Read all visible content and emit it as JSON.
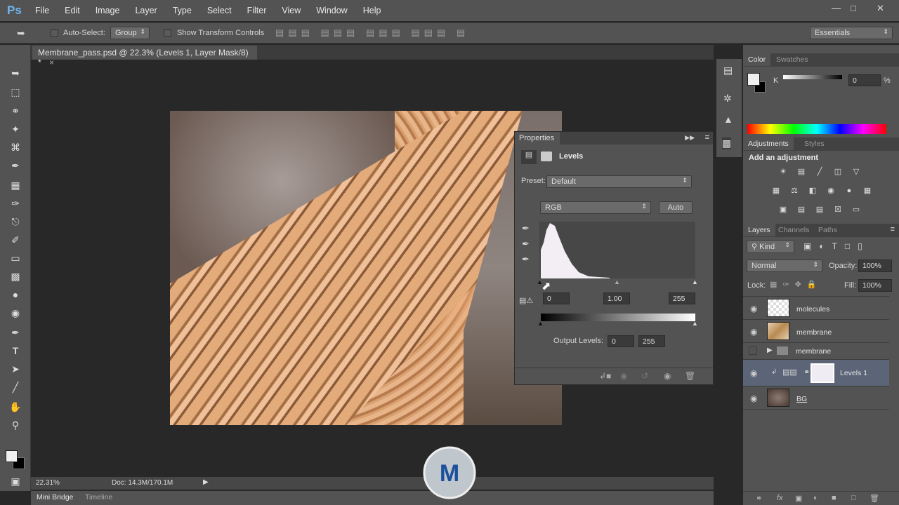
{
  "app": {
    "logo": "Ps",
    "menu": [
      "File",
      "Edit",
      "Image",
      "Layer",
      "Type",
      "Select",
      "Filter",
      "View",
      "Window",
      "Help"
    ],
    "window_controls": [
      "minimize",
      "maximize",
      "close"
    ]
  },
  "options": {
    "auto_select_label": "Auto-Select:",
    "auto_select_value": "Group",
    "transform_label": "Show Transform Controls",
    "workspace": "Essentials"
  },
  "document": {
    "tab_title": "Membrane_pass.psd @ 22.3% (Levels 1, Layer Mask/8) *",
    "zoom": "22.31%",
    "doc_size": "Doc: 14.3M/170.1M"
  },
  "bottom_tabs": [
    "Mini Bridge",
    "Timeline"
  ],
  "properties": {
    "title": "Properties",
    "adjustment": "Levels",
    "preset_label": "Preset:",
    "preset_value": "Default",
    "channel": "RGB",
    "auto_label": "Auto",
    "input_black": "0",
    "input_gamma": "1.00",
    "input_white": "255",
    "output_label": "Output Levels:",
    "output_black": "0",
    "output_white": "255"
  },
  "color_panel": {
    "tabs": [
      "Color",
      "Swatches"
    ],
    "channel": "K",
    "value": "0",
    "unit": "%"
  },
  "adjustments_panel": {
    "tabs": [
      "Adjustments",
      "Styles"
    ],
    "heading": "Add an adjustment"
  },
  "layers_panel": {
    "tabs": [
      "Layers",
      "Channels",
      "Paths"
    ],
    "filter": "Kind",
    "blend_mode": "Normal",
    "opacity_label": "Opacity:",
    "opacity": "100%",
    "lock_label": "Lock:",
    "fill_label": "Fill:",
    "fill": "100%",
    "layers": [
      {
        "name": "molecules",
        "visible": true
      },
      {
        "name": "membrane",
        "visible": true
      },
      {
        "name": "membrane",
        "visible": false,
        "type": "group"
      },
      {
        "name": "Levels 1",
        "visible": true,
        "selected": true,
        "type": "adjustment"
      },
      {
        "name": "BG",
        "visible": true
      }
    ]
  },
  "colors": {
    "accent": "#6fb6f0",
    "selected_layer": "#5b6577",
    "panel": "#535353"
  }
}
